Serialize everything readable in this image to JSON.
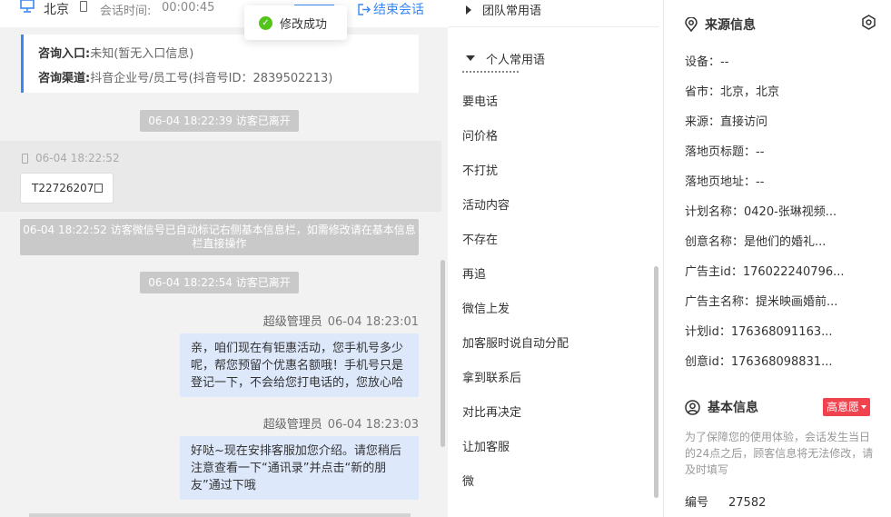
{
  "header": {
    "city": "北京",
    "session_time_label": "会话时间:",
    "session_time": "00:00:45",
    "end_session": "结束会话"
  },
  "toast": {
    "text": "修改成功"
  },
  "info_card": {
    "entry_label": "咨询入口:",
    "entry_value": "未知(暂无入口信息)",
    "channel_label": "咨询渠道:",
    "channel_value": "抖音企业号/员工号(抖音号ID：2839502213)"
  },
  "messages": {
    "left1": "06-04 18:22:39 访客已离开",
    "band_time": "06-04 18:22:52",
    "order_id": "T22726207",
    "auto_note": "06-04 18:22:52 访客微信号已自动标记右侧基本信息栏，如需修改请在基本信息栏直接操作",
    "left2": "06-04 18:22:54 访客已离开",
    "sender1_name": "超级管理员",
    "sender1_time": "06-04 18:23:01",
    "bubble1": "亲，咱们现在有钜惠活动，您手机号多少呢，帮您预留个优惠名额哦！手机号只是登记一下，不会给您打电话的，您放心哈",
    "sender2_name": "超级管理员",
    "sender2_time": "06-04 18:23:03",
    "bubble2": "好哒~现在安排客服加您介绍。请您稍后注意查看一下“通讯录”并点击“新的朋友”通过下哦"
  },
  "phrases": {
    "team_group": "团队常用语",
    "personal_group": "个人常用语",
    "items": [
      "要电话",
      "问价格",
      "不打扰",
      "活动内容",
      "不存在",
      "再追",
      "微信上发",
      "加客服时说自动分配",
      "拿到联系后",
      "对比再决定",
      "让加客服",
      "微"
    ]
  },
  "source_info": {
    "title": "来源信息",
    "rows": [
      "设备：--",
      "省市：北京，北京",
      "来源：直接访问",
      "落地页标题：--",
      "落地页地址：--",
      "计划名称：0420-张琳视频...",
      "创意名称：是他们的婚礼...",
      "广告主id：176022240796...",
      "广告主名称：提米映画婚前...",
      "计划id：176368091163...",
      "创意id：176368098831..."
    ]
  },
  "basic_info": {
    "title": "基本信息",
    "tag": "高意愿",
    "hint": "为了保障您的使用体验，会话发生当日的24点之后，顾客信息将无法修改，请及时填写",
    "id_label": "编号",
    "id_value": "27582"
  },
  "colors": {
    "accent": "#3a88f5",
    "success": "#52c41a",
    "tag": "#f0424f",
    "bubble": "#dde8fb"
  }
}
